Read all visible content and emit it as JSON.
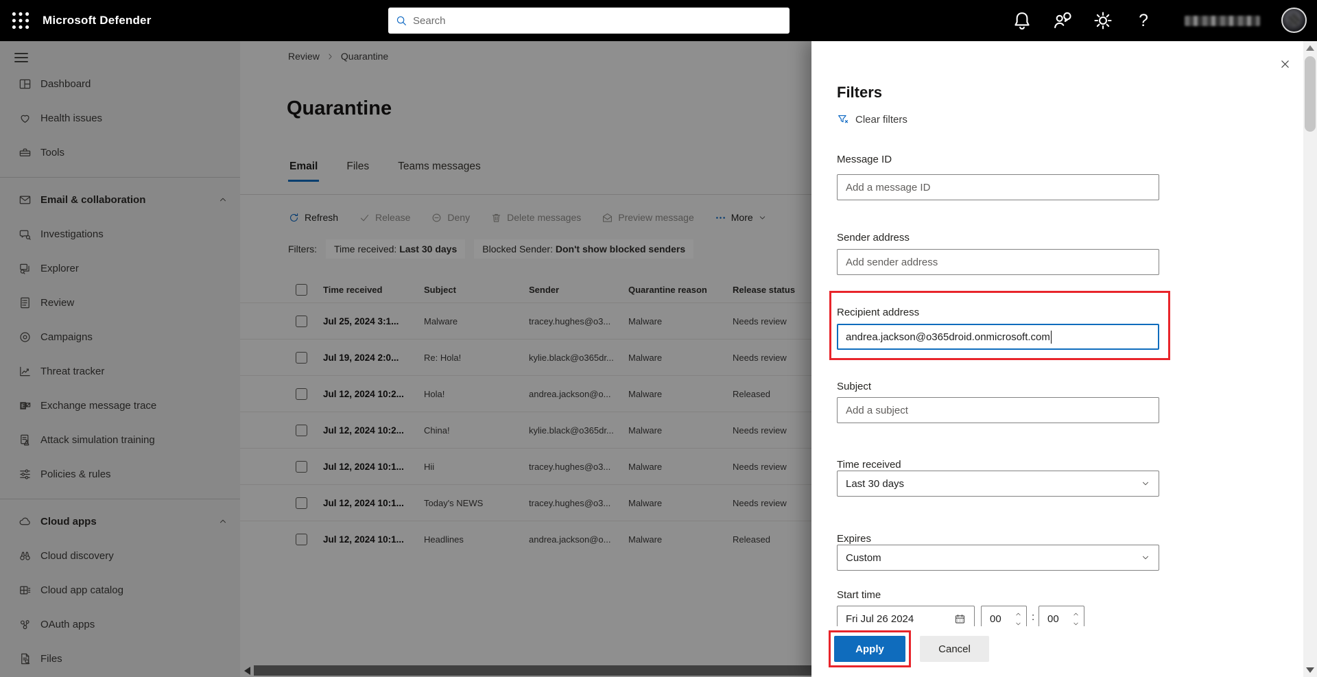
{
  "colors": {
    "accent_blue": "#0a66c2",
    "focus_border_blue": "#0f6cbd",
    "apply_button_blue": "#0f6cbd",
    "annotation_red": "#e8252b",
    "topbar_black": "#000000",
    "sidebar_gray": "#ebebeb"
  },
  "topbar": {
    "app_title": "Microsoft Defender",
    "search_placeholder": "Search",
    "icons": [
      "waffle",
      "notifications",
      "feedback",
      "settings",
      "help"
    ]
  },
  "sidebar": {
    "items": [
      {
        "type": "item",
        "label": "Dashboard",
        "icon": "dashboard"
      },
      {
        "type": "item",
        "label": "Health issues",
        "icon": "heart"
      },
      {
        "type": "item",
        "label": "Tools",
        "icon": "toolbox"
      },
      {
        "type": "divider"
      },
      {
        "type": "section",
        "label": "Email & collaboration",
        "icon": "mail",
        "chevron": "up"
      },
      {
        "type": "item",
        "label": "Investigations",
        "icon": "investigations"
      },
      {
        "type": "item",
        "label": "Explorer",
        "icon": "explorer"
      },
      {
        "type": "item",
        "label": "Review",
        "icon": "review"
      },
      {
        "type": "item",
        "label": "Campaigns",
        "icon": "campaigns"
      },
      {
        "type": "item",
        "label": "Threat tracker",
        "icon": "threat-tracker"
      },
      {
        "type": "item",
        "label": "Exchange message trace",
        "icon": "exchange"
      },
      {
        "type": "item",
        "label": "Attack simulation training",
        "icon": "attack-simulation"
      },
      {
        "type": "item",
        "label": "Policies & rules",
        "icon": "policies"
      },
      {
        "type": "divider"
      },
      {
        "type": "section",
        "label": "Cloud apps",
        "icon": "cloud",
        "chevron": "up"
      },
      {
        "type": "item",
        "label": "Cloud discovery",
        "icon": "binoculars"
      },
      {
        "type": "item",
        "label": "Cloud app catalog",
        "icon": "app-catalog"
      },
      {
        "type": "item",
        "label": "OAuth apps",
        "icon": "oauth"
      },
      {
        "type": "item",
        "label": "Files",
        "icon": "file-search"
      }
    ]
  },
  "main": {
    "breadcrumb": [
      "Review",
      "Quarantine"
    ],
    "page_title": "Quarantine",
    "tabs": [
      {
        "label": "Email",
        "active": true
      },
      {
        "label": "Files",
        "active": false
      },
      {
        "label": "Teams messages",
        "active": false
      }
    ],
    "toolbar": [
      {
        "label": "Refresh",
        "icon": "refresh",
        "enabled": true
      },
      {
        "label": "Release",
        "icon": "check",
        "enabled": false
      },
      {
        "label": "Deny",
        "icon": "block",
        "enabled": false
      },
      {
        "label": "Delete messages",
        "icon": "trash",
        "enabled": false
      },
      {
        "label": "Preview message",
        "icon": "mail-open",
        "enabled": false
      },
      {
        "label": "More",
        "icon": "ellipsis",
        "enabled": true,
        "chevron": true
      }
    ],
    "filters_label": "Filters:",
    "filter_chips": [
      {
        "label": "Time received:",
        "value": "Last 30 days"
      },
      {
        "label": "Blocked Sender:",
        "value": "Don't show blocked senders"
      }
    ],
    "table": {
      "columns": [
        "Time received",
        "Subject",
        "Sender",
        "Quarantine reason",
        "Release status"
      ],
      "rows": [
        {
          "time": "Jul 25, 2024 3:1...",
          "subject": "Malware",
          "sender": "tracey.hughes@o3...",
          "reason": "Malware",
          "status": "Needs review"
        },
        {
          "time": "Jul 19, 2024 2:0...",
          "subject": "Re: Hola!",
          "sender": "kylie.black@o365dr...",
          "reason": "Malware",
          "status": "Needs review"
        },
        {
          "time": "Jul 12, 2024 10:2...",
          "subject": "Hola!",
          "sender": "andrea.jackson@o...",
          "reason": "Malware",
          "status": "Released"
        },
        {
          "time": "Jul 12, 2024 10:2...",
          "subject": "China!",
          "sender": "kylie.black@o365dr...",
          "reason": "Malware",
          "status": "Needs review"
        },
        {
          "time": "Jul 12, 2024 10:1...",
          "subject": "Hii",
          "sender": "tracey.hughes@o3...",
          "reason": "Malware",
          "status": "Needs review"
        },
        {
          "time": "Jul 12, 2024 10:1...",
          "subject": "Today's NEWS",
          "sender": "tracey.hughes@o3...",
          "reason": "Malware",
          "status": "Needs review"
        },
        {
          "time": "Jul 12, 2024 10:1...",
          "subject": "Headlines",
          "sender": "andrea.jackson@o...",
          "reason": "Malware",
          "status": "Released"
        }
      ]
    }
  },
  "filters_panel": {
    "title": "Filters",
    "clear_filters_label": "Clear filters",
    "fields": {
      "message_id": {
        "label": "Message ID",
        "placeholder": "Add a message ID",
        "value": ""
      },
      "sender": {
        "label": "Sender address",
        "placeholder": "Add sender address",
        "value": ""
      },
      "recipient": {
        "label": "Recipient address",
        "value": "andrea.jackson@o365droid.onmicrosoft.com"
      },
      "subject": {
        "label": "Subject",
        "placeholder": "Add a subject",
        "value": ""
      },
      "time_received": {
        "label": "Time received",
        "value": "Last 30 days"
      },
      "expires": {
        "label": "Expires",
        "value": "Custom"
      },
      "start_time": {
        "label": "Start time",
        "date": "Fri Jul 26 2024",
        "hour": "00",
        "separator": ":",
        "minute": "00"
      }
    },
    "apply_label": "Apply",
    "cancel_label": "Cancel"
  }
}
